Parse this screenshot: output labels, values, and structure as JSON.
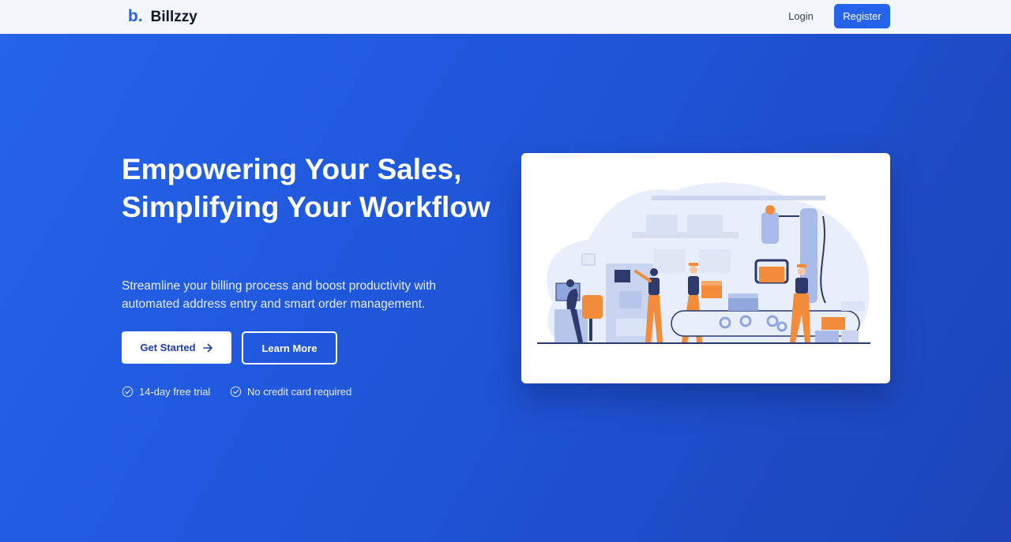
{
  "header": {
    "logo_mark": "b.",
    "brand_name": "Billzzy",
    "login_label": "Login",
    "register_label": "Register"
  },
  "hero": {
    "title": "Empowering Your Sales, Simplifying Your Workflow",
    "subtitle": "Streamline your billing process and boost productivity with automated address entry and smart order management.",
    "primary_cta": "Get Started",
    "primary_cta_icon": "arrow-right-icon",
    "secondary_cta": "Learn More",
    "features": [
      {
        "icon": "check-circle-icon",
        "label": "14-day free trial"
      },
      {
        "icon": "check-circle-icon",
        "label": "No credit card required"
      }
    ]
  },
  "colors": {
    "accent": "#2563eb",
    "hero_gradient_start": "#2563eb",
    "hero_gradient_end": "#1d44b8",
    "illustration_orange": "#f28c3a",
    "illustration_navy": "#2d3a6b"
  }
}
